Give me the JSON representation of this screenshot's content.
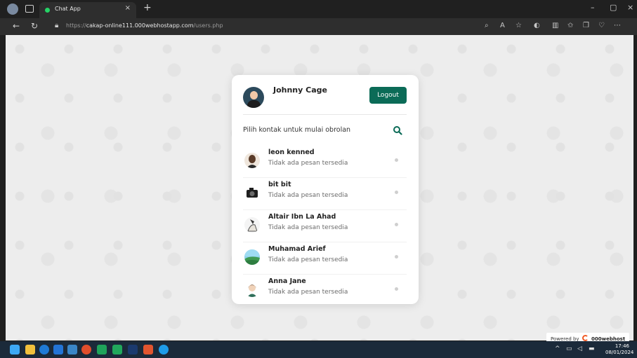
{
  "browser": {
    "tab_title": "Chat App",
    "tab_close": "×",
    "new_tab": "+",
    "url_scheme": "https://",
    "url_host": "cakap-online111.000webhostapp.com",
    "url_path": "/users.php",
    "window_minimize": "–",
    "window_restore": "▢",
    "window_close": "×"
  },
  "app": {
    "user_name": "Johnny Cage",
    "logout_label": "Logout",
    "search_prompt": "Pilih kontak untuk mulai obrolan",
    "contacts": [
      {
        "name": "leon kenned",
        "message": "Tidak ada pesan tersedia",
        "avatar": "leon-avatar"
      },
      {
        "name": "bit bit",
        "message": "Tidak ada pesan tersedia",
        "avatar": "camera-avatar"
      },
      {
        "name": "Altair Ibn La Ahad",
        "message": "Tidak ada pesan tersedia",
        "avatar": "altair-avatar"
      },
      {
        "name": "Muhamad Arief",
        "message": "Tidak ada pesan tersedia",
        "avatar": "landscape-avatar"
      },
      {
        "name": "Anna Jane",
        "message": "Tidak ada pesan tersedia",
        "avatar": "anna-avatar"
      }
    ]
  },
  "footer": {
    "powered_by": "Powered by",
    "brand": "000webhost"
  },
  "taskbar": {
    "time": "17:46",
    "date": "08/01/2024"
  },
  "colors": {
    "accent": "#0b6b57",
    "status_dot": "#cfcfcf"
  }
}
